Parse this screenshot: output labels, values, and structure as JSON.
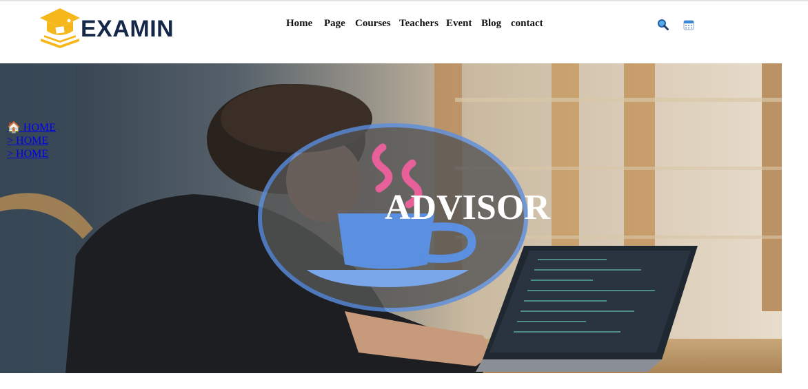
{
  "header": {
    "logo_text": "EXAMIN",
    "logo_icon": "graduation-cap-icon",
    "nav": [
      {
        "label": "Home"
      },
      {
        "label": "Page"
      },
      {
        "label": "Courses"
      },
      {
        "label": "Teachers"
      },
      {
        "label": "Event"
      },
      {
        "label": "Blog"
      },
      {
        "label": "contact"
      }
    ],
    "actions": [
      {
        "icon": "search-icon"
      },
      {
        "icon": "calendar-icon"
      }
    ]
  },
  "breadcrumb": [
    {
      "text": "🏠 HOME"
    },
    {
      "text": "> HOME"
    },
    {
      "text": "> HOME"
    }
  ],
  "hero": {
    "title": "ADVISOR",
    "emblem_icon": "coffee-cup-icon"
  },
  "colors": {
    "brand_navy": "#15284a",
    "brand_yellow": "#f6b71b",
    "link_blue": "#0000ee",
    "emblem_blue": "#5b8fe0",
    "steam_pink": "#e8609a"
  }
}
